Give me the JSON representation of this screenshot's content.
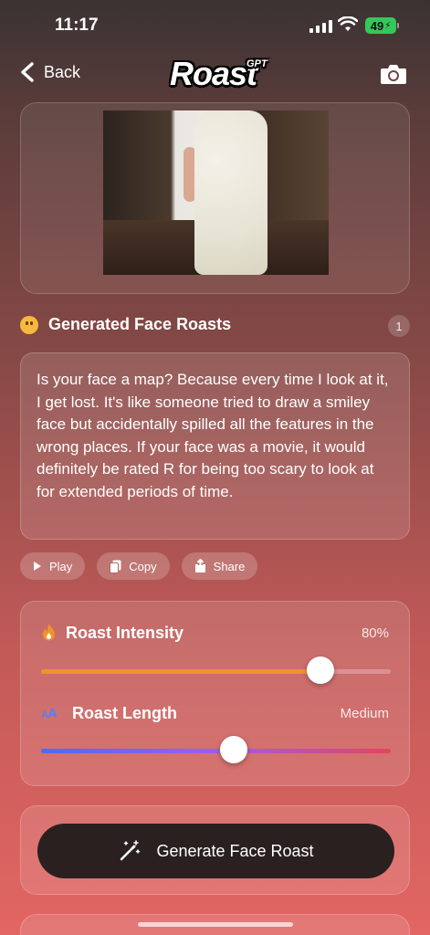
{
  "status": {
    "time": "11:17",
    "battery": "49"
  },
  "nav": {
    "back_label": "Back",
    "logo": "Roast",
    "logo_sup": "GPT"
  },
  "section": {
    "title": "Generated Face Roasts",
    "count": "1"
  },
  "roast": {
    "text": "Is your face a map? Because every time I look at it, I get lost. It's like someone tried to draw a smiley face but accidentally spilled all the features in the wrong places. If your face was a movie, it would definitely be rated R for being too scary to look at for extended periods of time."
  },
  "actions": {
    "play": "Play",
    "copy": "Copy",
    "share": "Share"
  },
  "settings": {
    "intensity": {
      "label": "Roast Intensity",
      "value": "80%",
      "level": 0.8,
      "color": "#f0932b"
    },
    "length": {
      "label": "Roast Length",
      "value": "Medium",
      "level": 0.55,
      "gradient": [
        "#4a6cf7",
        "#a05cf0",
        "#e2455f"
      ]
    }
  },
  "generate": {
    "label": "Generate Face Roast"
  }
}
